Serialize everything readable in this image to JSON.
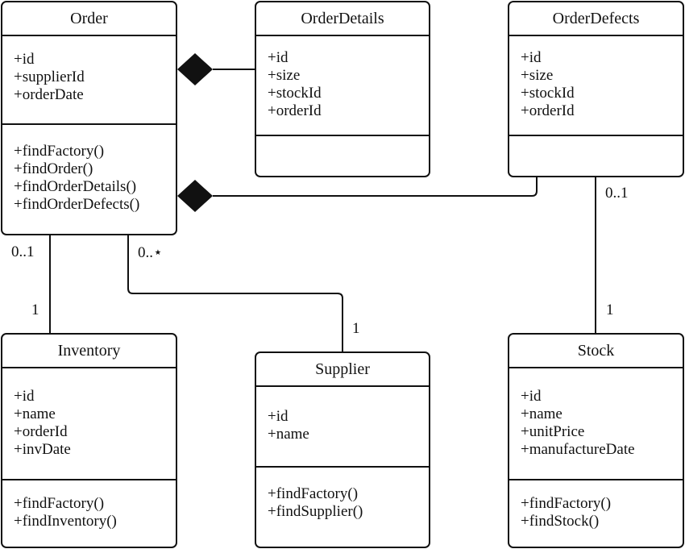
{
  "classes": {
    "order": {
      "name": "Order",
      "attributes": [
        "+id",
        "+supplierId",
        "+orderDate"
      ],
      "operations": [
        "+findFactory()",
        "+findOrder()",
        "+findOrderDetails()",
        "+findOrderDefects()"
      ]
    },
    "order_details": {
      "name": "OrderDetails",
      "attributes": [
        "+id",
        "+size",
        "+stockId",
        "+orderId"
      ],
      "operations": []
    },
    "order_defects": {
      "name": "OrderDefects",
      "attributes": [
        "+id",
        "+size",
        "+stockId",
        "+orderId"
      ],
      "operations": []
    },
    "inventory": {
      "name": "Inventory",
      "attributes": [
        "+id",
        "+name",
        "+orderId",
        "+invDate"
      ],
      "operations": [
        "+findFactory()",
        "+findInventory()"
      ]
    },
    "supplier": {
      "name": "Supplier",
      "attributes": [
        "+id",
        "+name"
      ],
      "operations": [
        "+findFactory()",
        "+findSupplier()"
      ]
    },
    "stock": {
      "name": "Stock",
      "attributes": [
        "+id",
        "+name",
        "+unitPrice",
        "+manufactureDate"
      ],
      "operations": [
        "+findFactory()",
        "+findStock()"
      ]
    }
  },
  "relations": [
    {
      "from": "Order",
      "to": "OrderDetails",
      "type": "composition"
    },
    {
      "from": "Order",
      "to": "OrderDefects",
      "type": "composition"
    },
    {
      "from": "Order",
      "to": "Inventory",
      "type": "association",
      "from_mult": "0..1",
      "to_mult": "1"
    },
    {
      "from": "Order",
      "to": "Supplier",
      "type": "association",
      "from_mult": "0..*",
      "to_mult": "1"
    },
    {
      "from": "OrderDefects",
      "to": "Stock",
      "type": "association",
      "from_mult": "0..1",
      "to_mult": "1"
    }
  ],
  "labels": {
    "order_inventory_from": "0..1",
    "order_inventory_to": "1",
    "order_supplier_from": "0..⋆",
    "order_supplier_to": "1",
    "defects_stock_from": "0..1",
    "defects_stock_to": "1"
  }
}
